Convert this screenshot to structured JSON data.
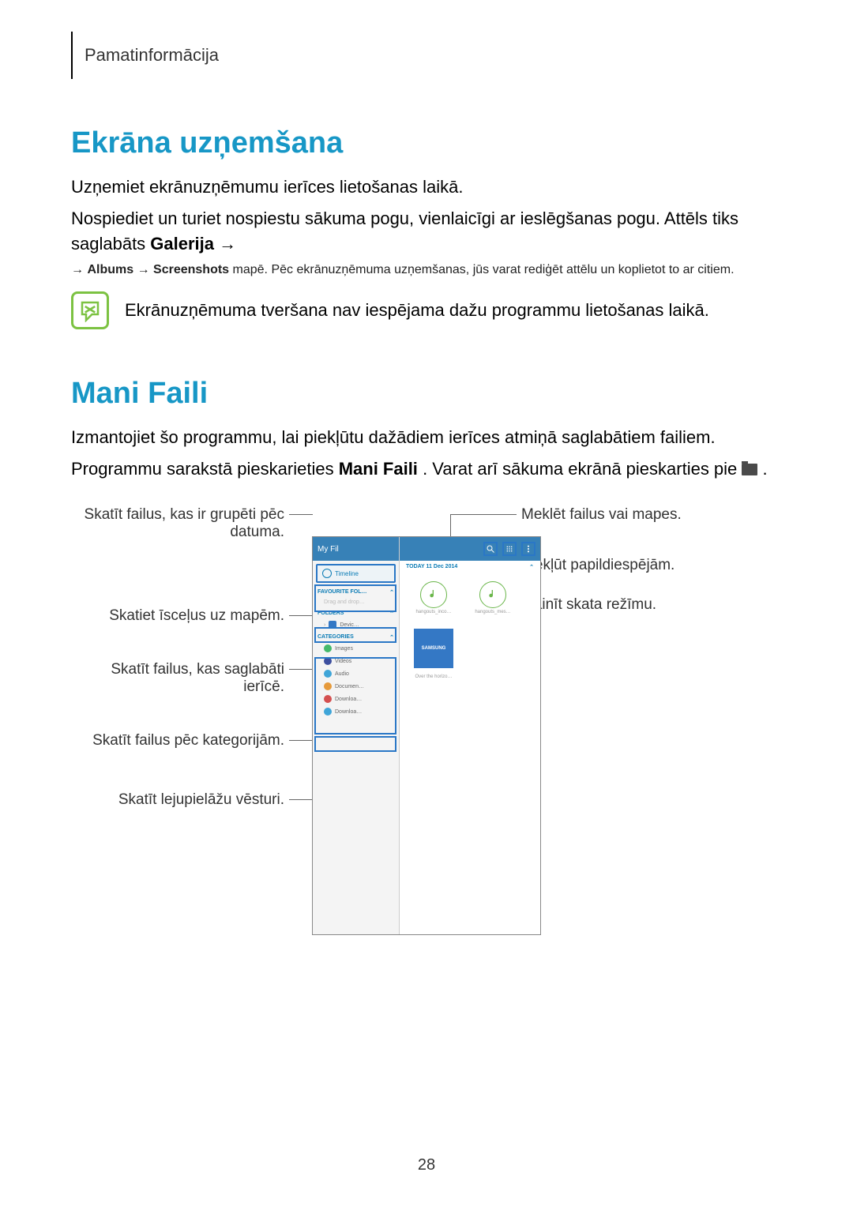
{
  "header": "Pamatinformācija",
  "section1": {
    "title": "Ekrāna uzņemšana",
    "p1": "Uzņemiet ekrānuzņēmumu ierīces lietošanas laikā.",
    "p2a": "Nospiediet un turiet nospiestu sākuma pogu, vienlaicīgi ar ieslēgšanas pogu. Attēls tiks saglabāts ",
    "p2b": "Galerija",
    "p2c": " → ",
    "p2d": " → ",
    "p2e": "Albums",
    "p2f": " → ",
    "p2g": "Screenshots",
    "p2h": " mapē. Pēc ekrānuzņēmuma uzņemšanas, jūs varat rediģēt attēlu un koplietot to ar citiem.",
    "note": "Ekrānuzņēmuma tveršana nav iespējama dažu programmu lietošanas laikā."
  },
  "section2": {
    "title": "Mani Faili",
    "p1": "Izmantojiet šo programmu, lai piekļūtu dažādiem ierīces atmiņā saglabātiem failiem.",
    "p2a": "Programmu sarakstā pieskarieties ",
    "p2b": "Mani Faili",
    "p2c": ". Varat arī sākuma ekrānā pieskarties pie ",
    "p2d": "."
  },
  "callouts": {
    "l1": "Skatīt failus, kas ir grupēti pēc datuma.",
    "l2": "Skatiet īsceļus uz mapēm.",
    "l3": "Skatīt failus, kas saglabāti ierīcē.",
    "l4": "Skatīt failus pēc kategorijām.",
    "l5": "Skatīt lejupielāžu vēsturi.",
    "r1": "Meklēt failus vai mapes.",
    "r2": "Piekļūt papildiespējām.",
    "r3": "Mainīt skata režīmu."
  },
  "shot": {
    "title": "My Fil",
    "timeline": "Timeline",
    "fav": "FAVOURITE FOL…",
    "drag": "Drag and drop…",
    "folders": "FOLDERS",
    "device": "Devic…",
    "cats": "CATEGORIES",
    "images": "Images",
    "videos": "Videos",
    "audio": "Audio",
    "docs": "Documen…",
    "dl1": "Downloa…",
    "dl2": "Downloa…",
    "today": "TODAY  11 Dec 2014",
    "f1": "hangouts_inco…",
    "f2": "hangouts_mes…",
    "samsung": "SAMSUNG",
    "horizons": "Over the horizo…",
    "chev": "⌃"
  },
  "page": "28"
}
